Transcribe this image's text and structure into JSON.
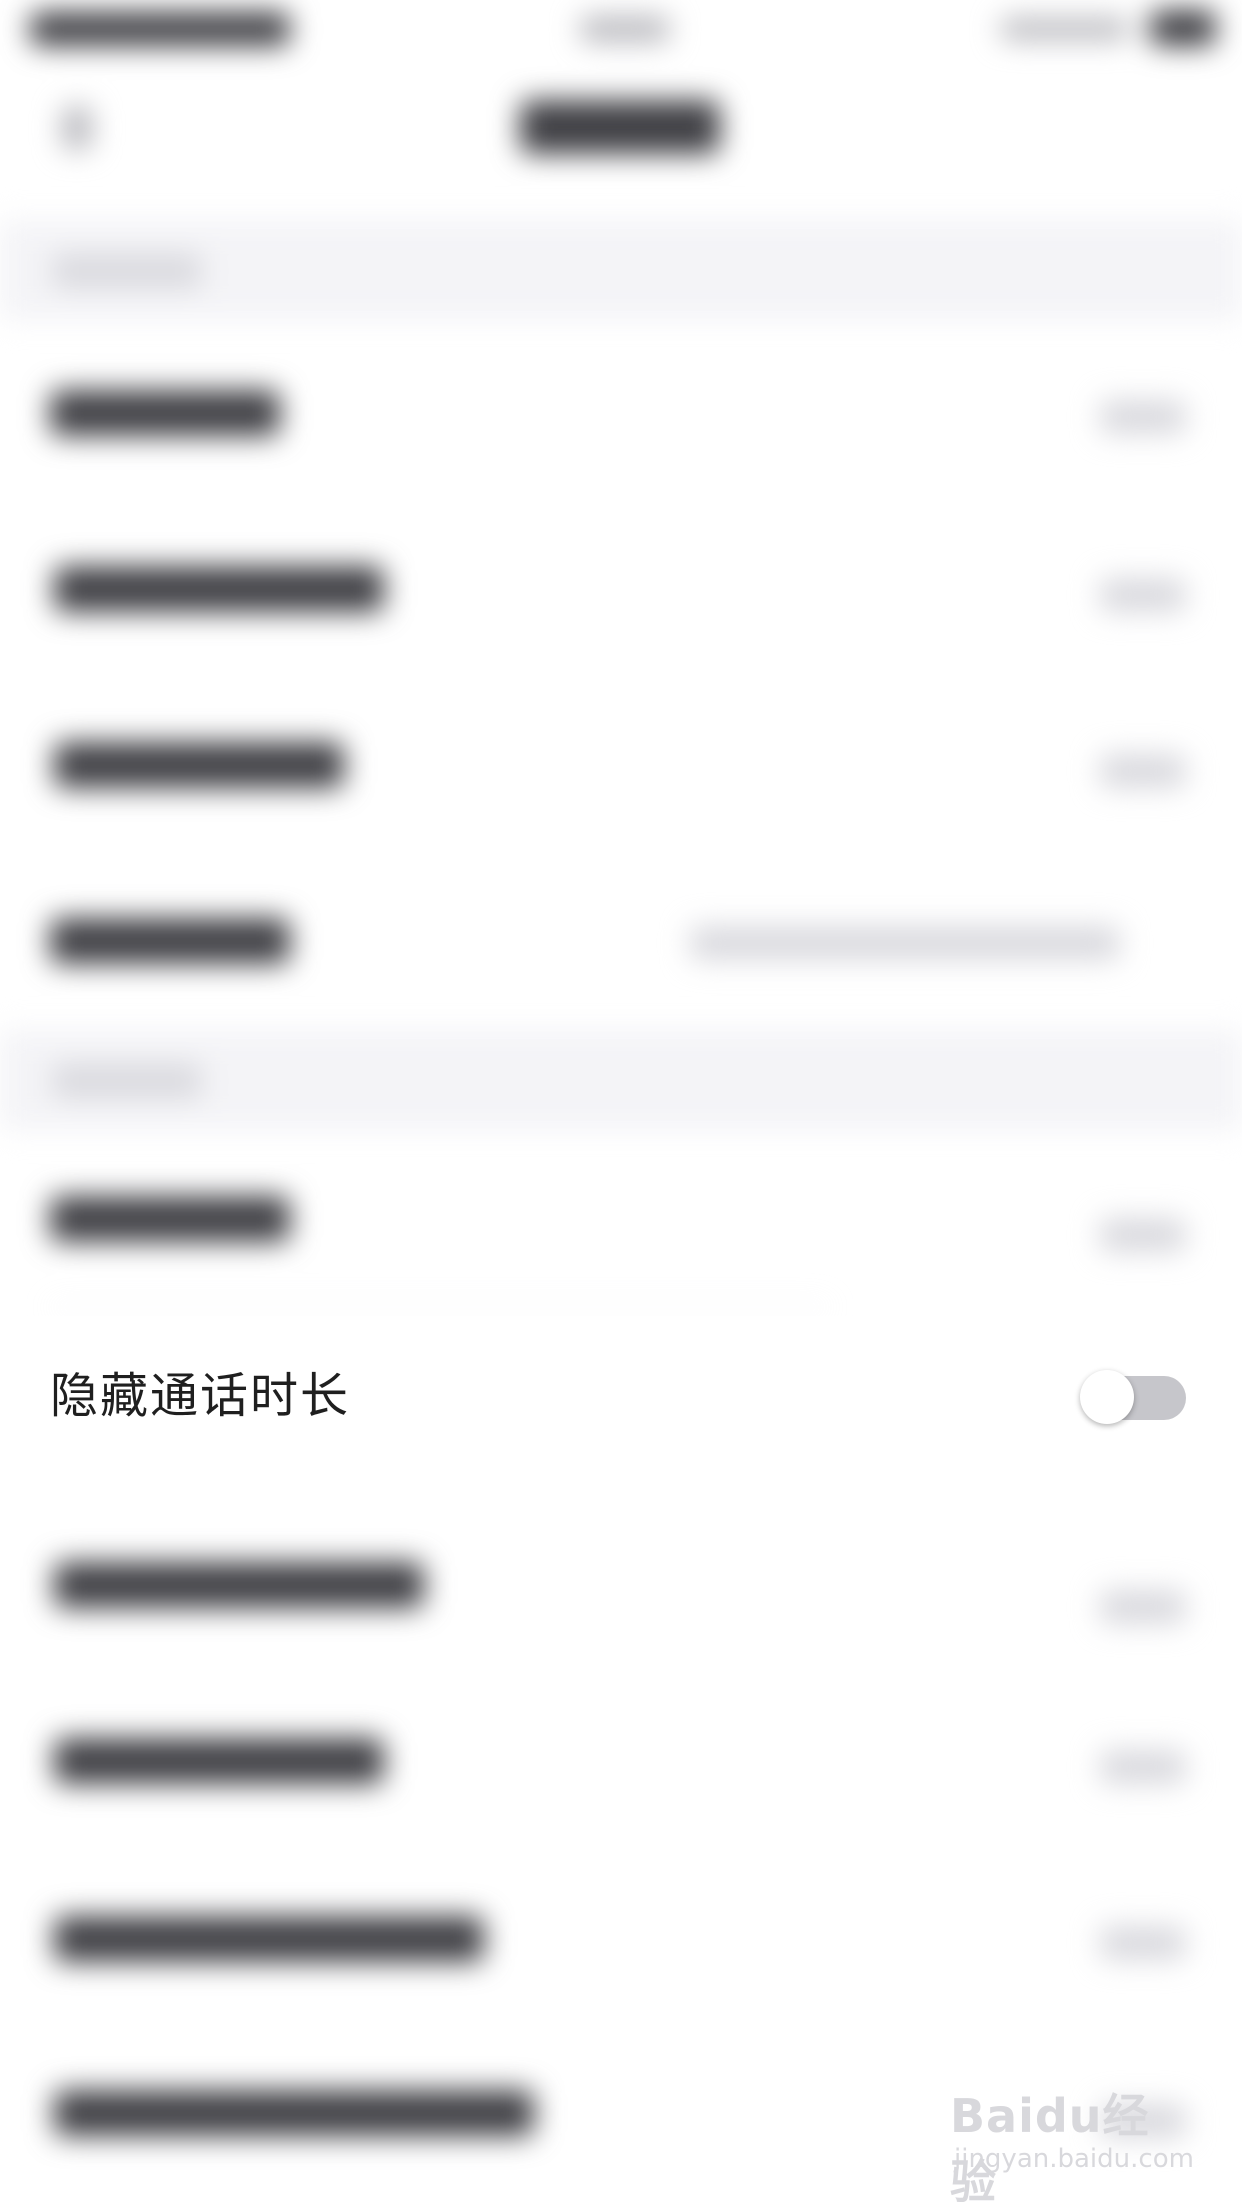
{
  "setting_row": {
    "label": "隐藏通话时长",
    "toggle_on": false
  },
  "watermark": {
    "brand": "Baidu经验",
    "url": "jingyan.baidu.com"
  },
  "colors": {
    "background": "#ffffff",
    "section_bar": "#f4f4f7",
    "toggle_track_off": "#c6c6cb",
    "label_text": "#1f1f1f"
  }
}
